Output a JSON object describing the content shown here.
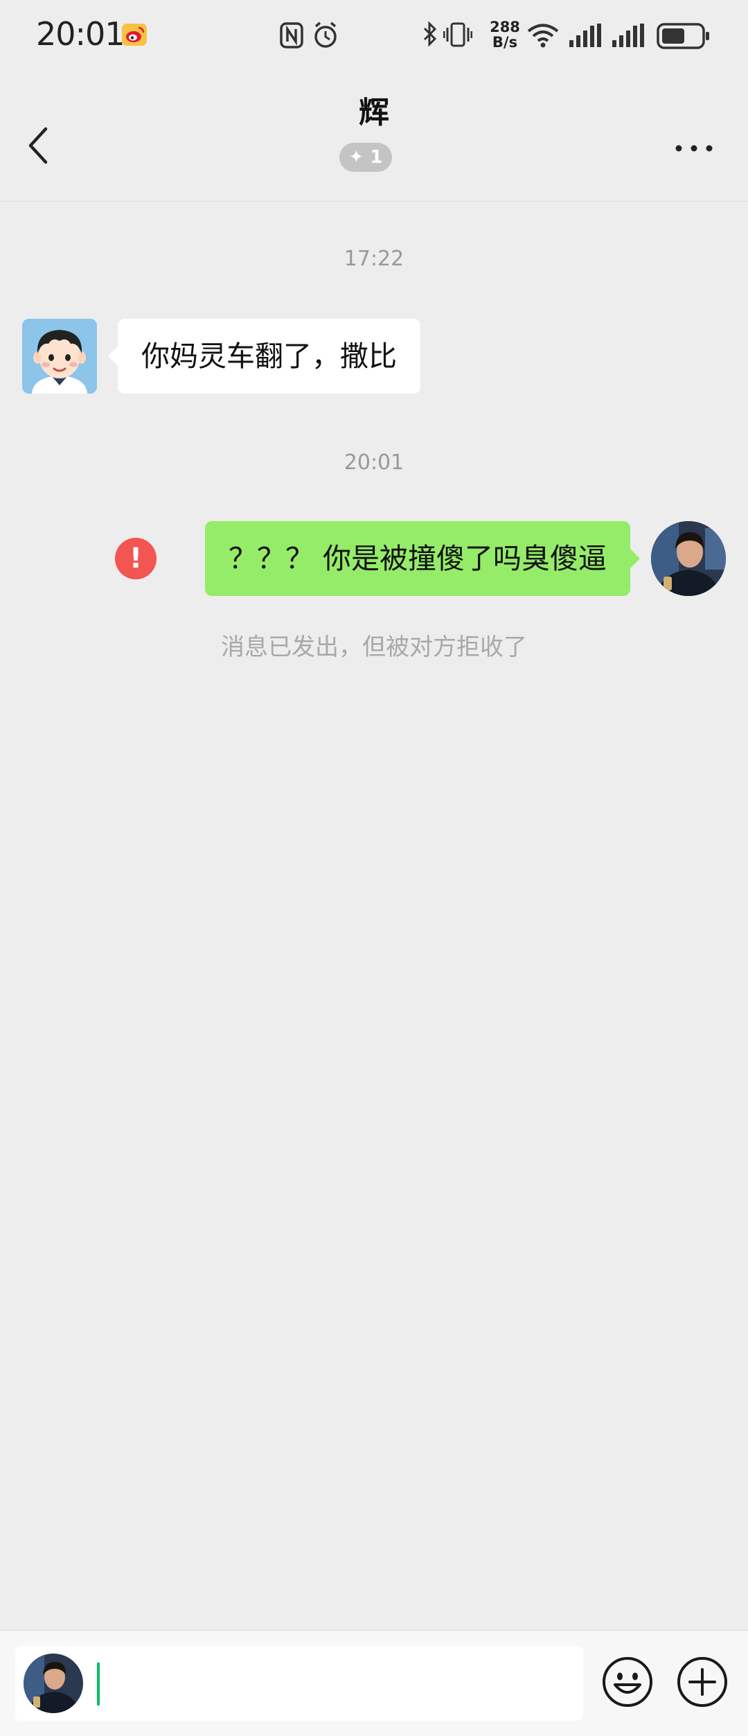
{
  "status_bar": {
    "time": "20:01",
    "net_speed_value": "288",
    "net_speed_unit": "B/s",
    "icons": [
      "weibo-icon",
      "nfc-icon",
      "alarm-icon",
      "bluetooth-icon",
      "vibrate-icon",
      "wifi-icon",
      "signal-icon",
      "signal-icon",
      "battery-icon"
    ]
  },
  "header": {
    "title": "辉",
    "badge": "✦ 1",
    "back_icon": "chevron-left-icon",
    "more_icon": "more-dots-icon"
  },
  "messages": [
    {
      "type": "time",
      "text": "17:22"
    },
    {
      "type": "incoming",
      "text": "你妈灵车翻了，撒比",
      "avatar": "cartoon-boy-avatar"
    },
    {
      "type": "time",
      "text": "20:01"
    },
    {
      "type": "outgoing",
      "text": "？？？ 你是被撞傻了吗臭傻逼",
      "status_icon": "error-icon",
      "status_glyph": "!",
      "avatar": "user-photo-avatar"
    },
    {
      "type": "system",
      "text": "消息已发出，但被对方拒收了"
    }
  ],
  "input_bar": {
    "value": "",
    "emoji_icon": "emoji-icon",
    "plus_icon": "plus-circle-icon"
  },
  "colors": {
    "background": "#ededed",
    "outgoing_bubble": "#95ec69",
    "incoming_bubble": "#ffffff",
    "error": "#f35552",
    "cursor": "#07c160"
  }
}
